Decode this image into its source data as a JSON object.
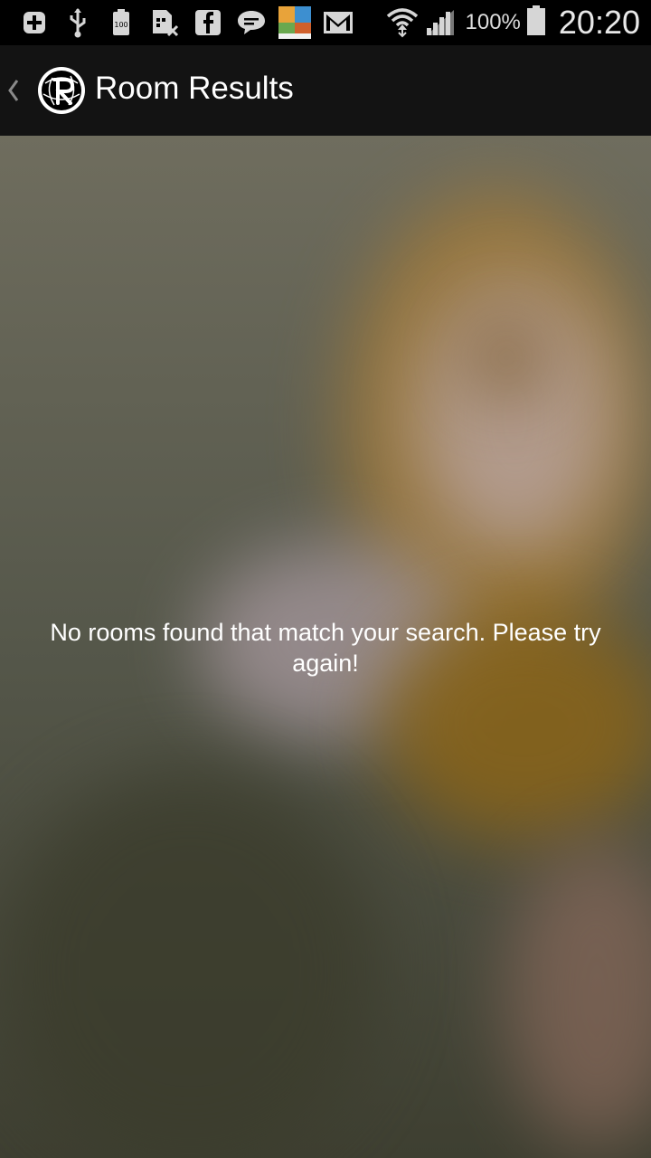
{
  "status_bar": {
    "icons": [
      "add-notification-icon",
      "usb-icon",
      "battery-100-notification-icon",
      "sim-error-icon",
      "facebook-icon",
      "chat-icon",
      "app-notification-icon",
      "gmail-icon",
      "wifi-icon",
      "signal-icon",
      "battery-icon"
    ],
    "battery_percent": "100%",
    "time": "20:20"
  },
  "action_bar": {
    "title": "Room Results",
    "logo": "app-logo-icon",
    "back_icon": "back-chevron-icon"
  },
  "content": {
    "empty_message": "No rooms found that match your search. Please try again!"
  },
  "colors": {
    "status_bar_bg": "#000000",
    "action_bar_bg": "#131313",
    "text": "#ffffff"
  }
}
